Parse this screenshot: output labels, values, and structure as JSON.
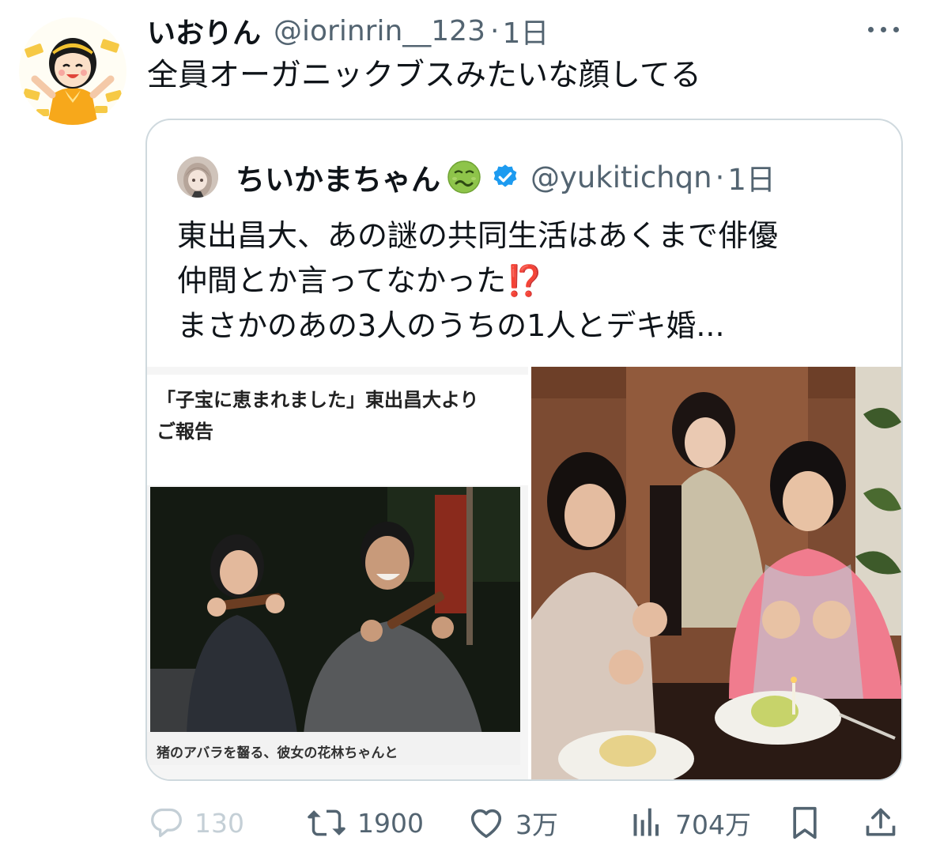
{
  "tweet": {
    "display_name": "いおりん",
    "handle": "@iorinrin__123",
    "separator": "·",
    "time": "1日",
    "text": "全員オーガニックブスみたいな顔してる",
    "avatar_icon": "illustrated-girl-avatar-icon"
  },
  "quoted_tweet": {
    "display_name": "ちいかまちゃん",
    "name_emoji": "nauseated-face-emoji-icon",
    "verified": true,
    "handle": "@yukitichqn",
    "separator": "·",
    "time": "1日",
    "text_lines": [
      "東出昌大、あの謎の共同生活はあくまで俳優",
      "仲間とか言ってなかった⁉️",
      "まさかのあの3人のうちの1人とデキ婚..."
    ],
    "media": {
      "article_headline_lines": [
        "「子宝に恵まれました」東出昌大より",
        "ご報告"
      ],
      "article_caption": "猪のアバラを齧る、彼女の花林ちゃんと",
      "article_photo_icon": "couple-eating-photo",
      "group_photo_icon": "three-women-birthday-photo"
    }
  },
  "actions": {
    "reply_count": "130",
    "retweet_count": "1900",
    "like_count": "3万",
    "views_count": "704万"
  },
  "colors": {
    "text_primary": "#0f1419",
    "text_secondary": "#536471",
    "verified_blue": "#1d9bf0",
    "border": "#cfd9de"
  }
}
